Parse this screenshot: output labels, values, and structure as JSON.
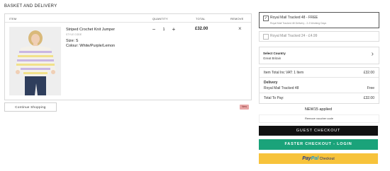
{
  "page": {
    "title": "BASKET AND DELIVERY"
  },
  "table": {
    "headers": {
      "item": "ITEM",
      "quantity": "QUANTITY",
      "total": "TOTAL",
      "remove": "REMOVE"
    }
  },
  "item": {
    "name": "Striped Crochet Knit Jumper",
    "code": "STYLE CODE",
    "size": "Size: S",
    "colour": "Colour: White/Purple/Lemon",
    "quantity": "1",
    "total": "£32.00",
    "remove_symbol": "×"
  },
  "actions": {
    "continue_shopping": "Continue Shopping",
    "new_badge": "New",
    "remove_voucher": "Remove voucher code",
    "guest_checkout": "GUEST CHECKOUT",
    "faster_checkout": "FASTER CHECKOUT - LOGIN",
    "paypal_checkout": "Checkout"
  },
  "delivery_options": [
    {
      "label": "Royal Mail Tracked 48 - FREE",
      "sub": "Royal Mail Tracked 48 Delivery - 2-3 Working Days",
      "checked": true
    },
    {
      "label": "Royal Mail Tracked 24 - £4.99",
      "sub": "",
      "checked": false
    }
  ],
  "country": {
    "label": "Select Country",
    "value": "Great Britain"
  },
  "summary": {
    "item_total_label": "Item Total Inc VAT: 1 Item",
    "item_total_value": "£32.00",
    "delivery_label": "Delivery",
    "delivery_method": "Royal Mail Tracked 48",
    "delivery_value": "Free",
    "to_pay_label": "Total To Pay:",
    "to_pay_value": "£32.00"
  },
  "promo": {
    "applied_text": "NEW15 applied"
  },
  "paypal": {
    "word1": "Pay",
    "word2": "Pal"
  },
  "colors": {
    "guest": "#111111",
    "faster": "#1aa37a",
    "paypal": "#f7c33b"
  }
}
